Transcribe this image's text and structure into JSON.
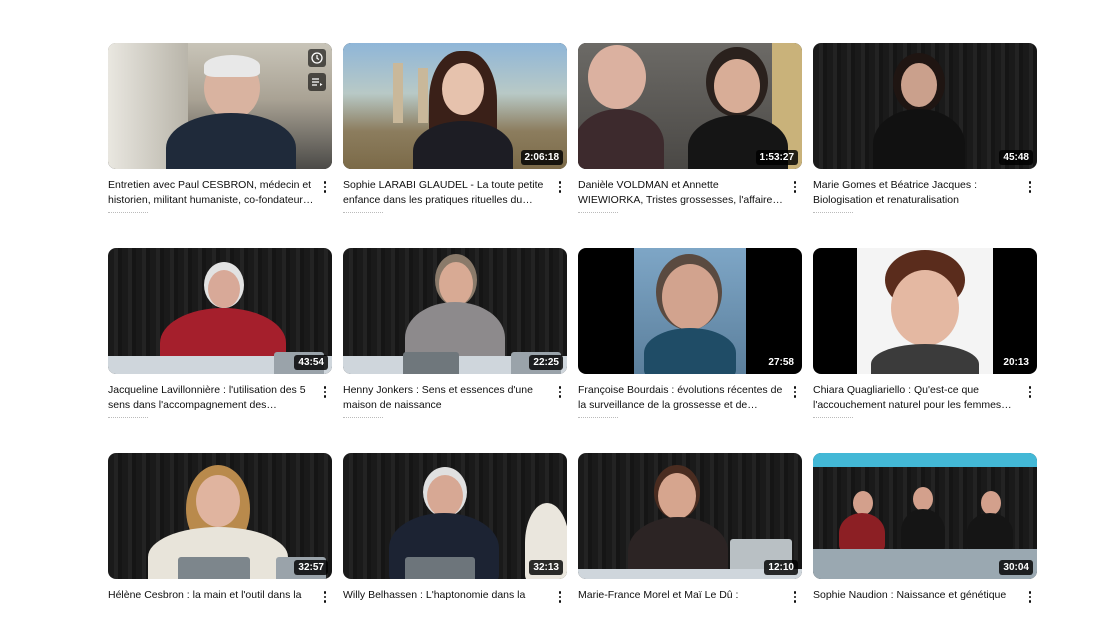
{
  "videos": [
    {
      "title": "Entretien avec Paul CESBRON, médecin et historien, militant humaniste, co-fondateur…",
      "duration": ""
    },
    {
      "title": "Sophie LARABI GLAUDEL - La toute petite enfance dans les pratiques rituelles du…",
      "duration": "2:06:18"
    },
    {
      "title": "Danièle VOLDMAN et Annette WIEWIORKA, Tristes grossesses, l'affaire des époux Bac…",
      "duration": "1:53:27"
    },
    {
      "title": "Marie Gomes et Béatrice Jacques : Biologisation et renaturalisation",
      "duration": "45:48"
    },
    {
      "title": "Jacqueline Lavillonnière : l'utilisation des 5 sens dans l'accompagnement des…",
      "duration": "43:54"
    },
    {
      "title": "Henny Jonkers : Sens et essences d'une maison de naissance",
      "duration": "22:25"
    },
    {
      "title": "Françoise Bourdais : évolutions récentes de la surveillance de la grossesse et de…",
      "duration": "27:58"
    },
    {
      "title": "Chiara Quagliariello : Qu'est-ce que l'accouchement naturel pour les femmes…",
      "duration": "20:13"
    },
    {
      "title": "Hélène Cesbron : la main et l'outil dans la",
      "duration": "32:57"
    },
    {
      "title": "Willy Belhassen : L'haptonomie dans la",
      "duration": "32:13"
    },
    {
      "title": "Marie-France Morel et Maï Le Dû :",
      "duration": "12:10"
    },
    {
      "title": "Sophie Naudion : Naissance et génétique",
      "duration": "30:04"
    }
  ],
  "icons": {
    "watch_later": "clock-icon",
    "add_to_queue": "queue-icon",
    "menu": "more-vert-icon"
  }
}
